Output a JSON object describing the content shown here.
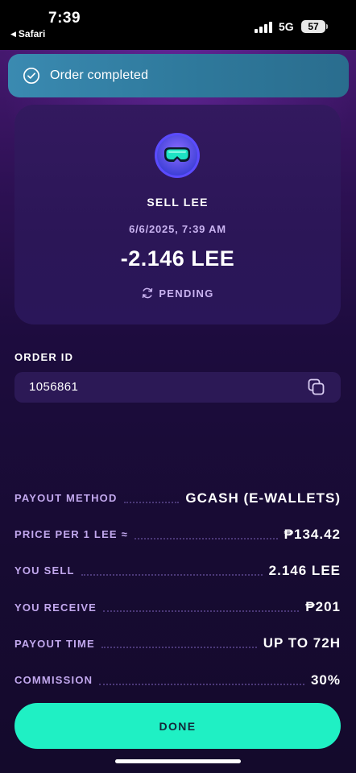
{
  "status_bar": {
    "time": "7:39",
    "back_app": "Safari",
    "network": "5G",
    "battery": "57"
  },
  "toast": {
    "icon": "check-circle-icon",
    "text": "Order completed"
  },
  "order_card": {
    "icon": "lee-coin-icon",
    "title": "SELL LEE",
    "date": "6/6/2025, 7:39 AM",
    "amount": "-2.146 LEE",
    "status_icon": "refresh-icon",
    "status": "PENDING"
  },
  "order_id": {
    "label": "ORDER ID",
    "value": "1056861",
    "copy_icon": "copy-icon"
  },
  "details": [
    {
      "label": "PAYOUT METHOD",
      "value": "GCASH (E-WALLETS)"
    },
    {
      "label": "PRICE PER 1 LEE ≈",
      "value": "₱134.42"
    },
    {
      "label": "YOU SELL",
      "value": "2.146 LEE"
    },
    {
      "label": "YOU RECEIVE",
      "value": "₱201"
    },
    {
      "label": "PAYOUT TIME",
      "value": "UP TO 72H"
    },
    {
      "label": "COMMISSION",
      "value": "30%"
    }
  ],
  "done_button": {
    "label": "DONE"
  },
  "colors": {
    "accent": "#1ff0c4",
    "toast": "#2f7a9d",
    "card": "#2b1657",
    "label": "#c2a8ee"
  }
}
